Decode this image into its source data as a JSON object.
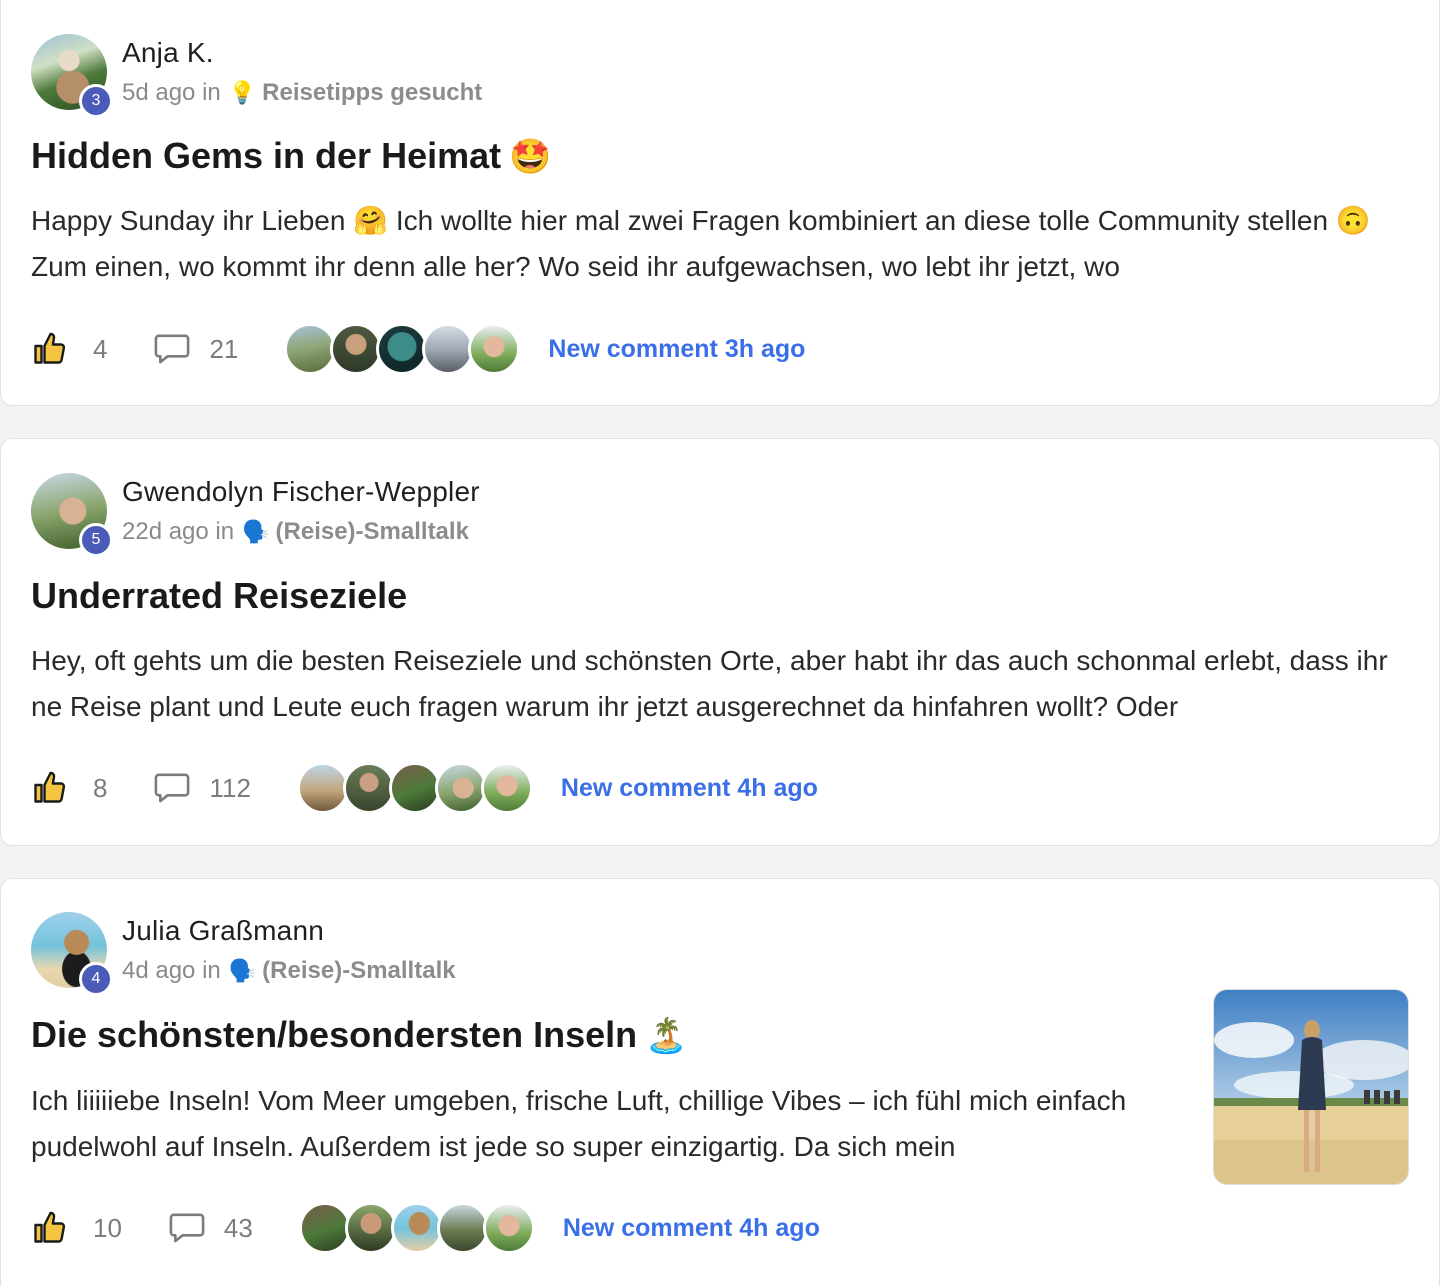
{
  "posts": [
    {
      "author": "Anja K.",
      "level": "3",
      "time": "5d ago in",
      "space_icon": "lightbulb-icon",
      "space_glyph": "💡",
      "space": "Reisetipps gesucht",
      "title": "Hidden Gems in der Heimat",
      "title_emoji": "🤩",
      "body": "Happy Sunday ihr Lieben 🤗 Ich wollte hier mal zwei Fragen kombiniert an diese tolle Community stellen 🙃 Zum einen, wo kommt ihr denn alle her? Wo seid ihr aufgewachsen, wo lebt ihr jetzt, wo",
      "likes": "4",
      "comments": "21",
      "last_comment": "New comment 3h ago"
    },
    {
      "author": "Gwendolyn Fischer-Weppler",
      "level": "5",
      "time": "22d ago in",
      "space_icon": "speaking-head-icon",
      "space_glyph": "🗣️",
      "space": "(Reise)-Smalltalk",
      "title": "Underrated Reiseziele",
      "title_emoji": "",
      "body": "Hey, oft gehts um die besten Reiseziele und schönsten Orte, aber habt ihr das auch schonmal erlebt, dass ihr ne Reise plant und Leute euch fragen warum ihr jetzt ausgerechnet da hinfahren wollt? Oder",
      "likes": "8",
      "comments": "112",
      "last_comment": "New comment 4h ago"
    },
    {
      "author": "Julia Graßmann",
      "level": "4",
      "time": "4d ago in",
      "space_icon": "speaking-head-icon",
      "space_glyph": "🗣️",
      "space": "(Reise)-Smalltalk",
      "title": "Die schönsten/besondersten Inseln",
      "title_emoji": "🏝️",
      "body": "Ich liiiiiebe Inseln! Vom Meer umgeben, frische Luft, chillige Vibes – ich fühl mich einfach pudelwohl auf Inseln. Außerdem ist jede so super einzigartig. Da sich mein",
      "likes": "10",
      "comments": "43",
      "last_comment": "New comment 4h ago"
    }
  ],
  "colors": {
    "accent_link": "#3a6fe8",
    "level_badge": "#4a5bb8",
    "like_icon": "#f5c542"
  }
}
